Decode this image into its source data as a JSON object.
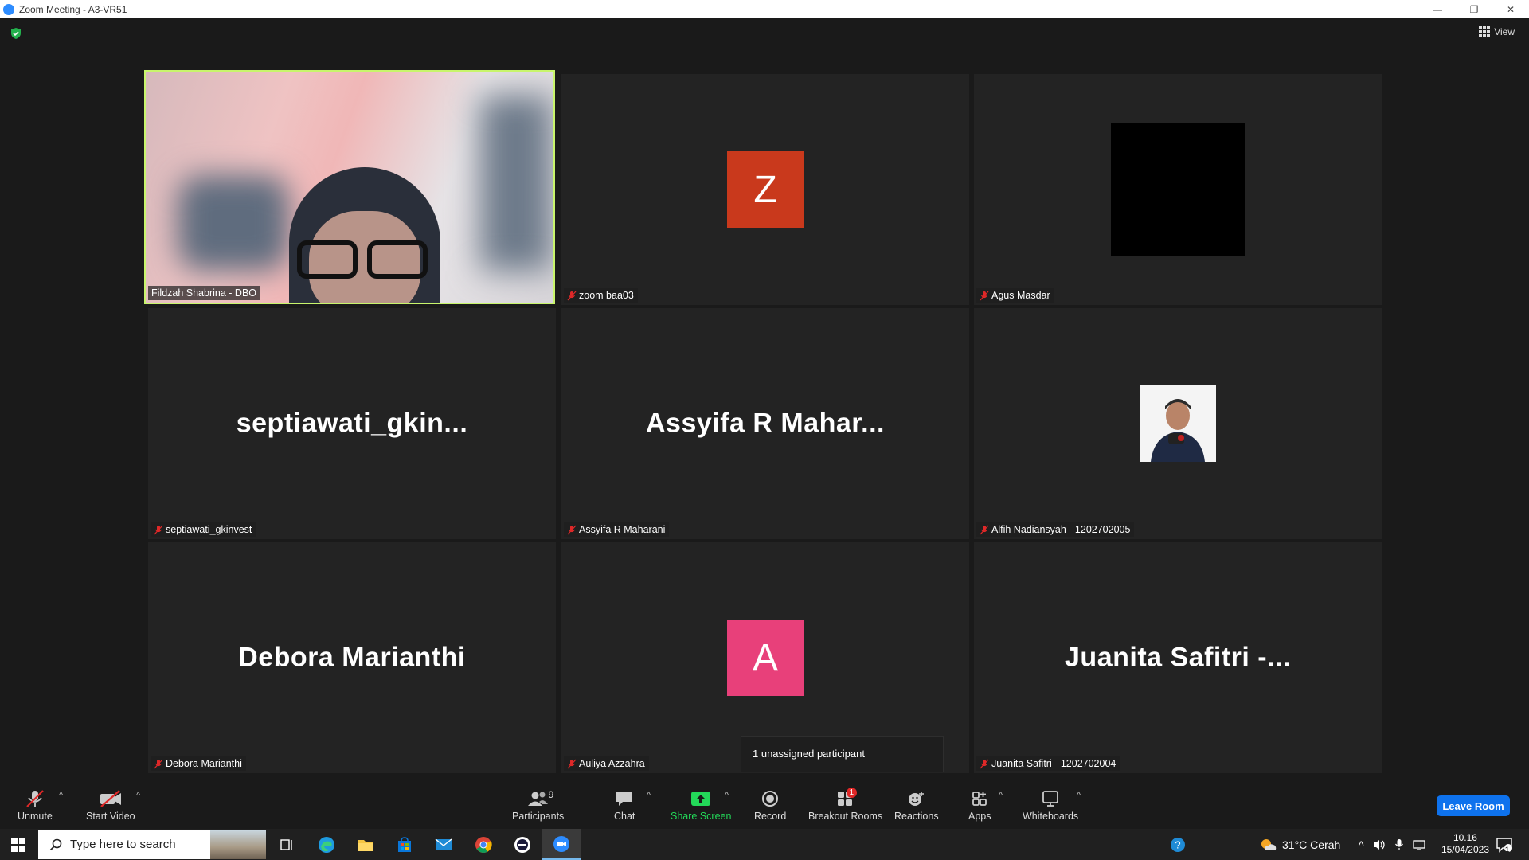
{
  "window": {
    "title": "Zoom Meeting - A3-VR51",
    "min": "—",
    "restore": "❐",
    "close": "✕"
  },
  "view_label": "View",
  "tiles": [
    {
      "name": "Fildzah Shabrina - DBO",
      "display": "",
      "muted": false,
      "kind": "video",
      "active": true
    },
    {
      "name": "zoom baa03",
      "display": "Z",
      "muted": true,
      "kind": "letter",
      "color": "#c9391c"
    },
    {
      "name": "Agus Masdar",
      "display": "",
      "muted": true,
      "kind": "black"
    },
    {
      "name": "septiawati_gkinvest",
      "display": "septiawati_gkin...",
      "muted": true,
      "kind": "text"
    },
    {
      "name": "Assyifa R Maharani",
      "display": "Assyifa R Mahar...",
      "muted": true,
      "kind": "text"
    },
    {
      "name": "Alfih Nadiansyah - 1202702005",
      "display": "",
      "muted": true,
      "kind": "photo"
    },
    {
      "name": "Debora Marianthi",
      "display": "Debora Marianthi",
      "muted": true,
      "kind": "text"
    },
    {
      "name": "Auliya Azzahra",
      "display": "A",
      "muted": true,
      "kind": "letter",
      "color": "#e8407a"
    },
    {
      "name": "Juanita Safitri - 1202702004",
      "display": "Juanita Safitri -...",
      "muted": true,
      "kind": "text"
    }
  ],
  "tooltip": "1 unassigned participant",
  "toolbar": {
    "unmute": "Unmute",
    "start_video": "Start Video",
    "participants": "Participants",
    "participants_count": "9",
    "chat": "Chat",
    "share_screen": "Share Screen",
    "record": "Record",
    "breakout_rooms": "Breakout Rooms",
    "breakout_badge": "1",
    "reactions": "Reactions",
    "apps": "Apps",
    "whiteboards": "Whiteboards",
    "leave": "Leave Room"
  },
  "taskbar": {
    "search_placeholder": "Type here to search",
    "weather": "31°C  Cerah",
    "time": "10.16",
    "date": "15/04/2023",
    "notification_count": "1"
  },
  "colors": {
    "accent": "#0e72ed",
    "active_speaker": "#c8f56c",
    "share_green": "#23d959",
    "mute_red": "#e02828"
  }
}
